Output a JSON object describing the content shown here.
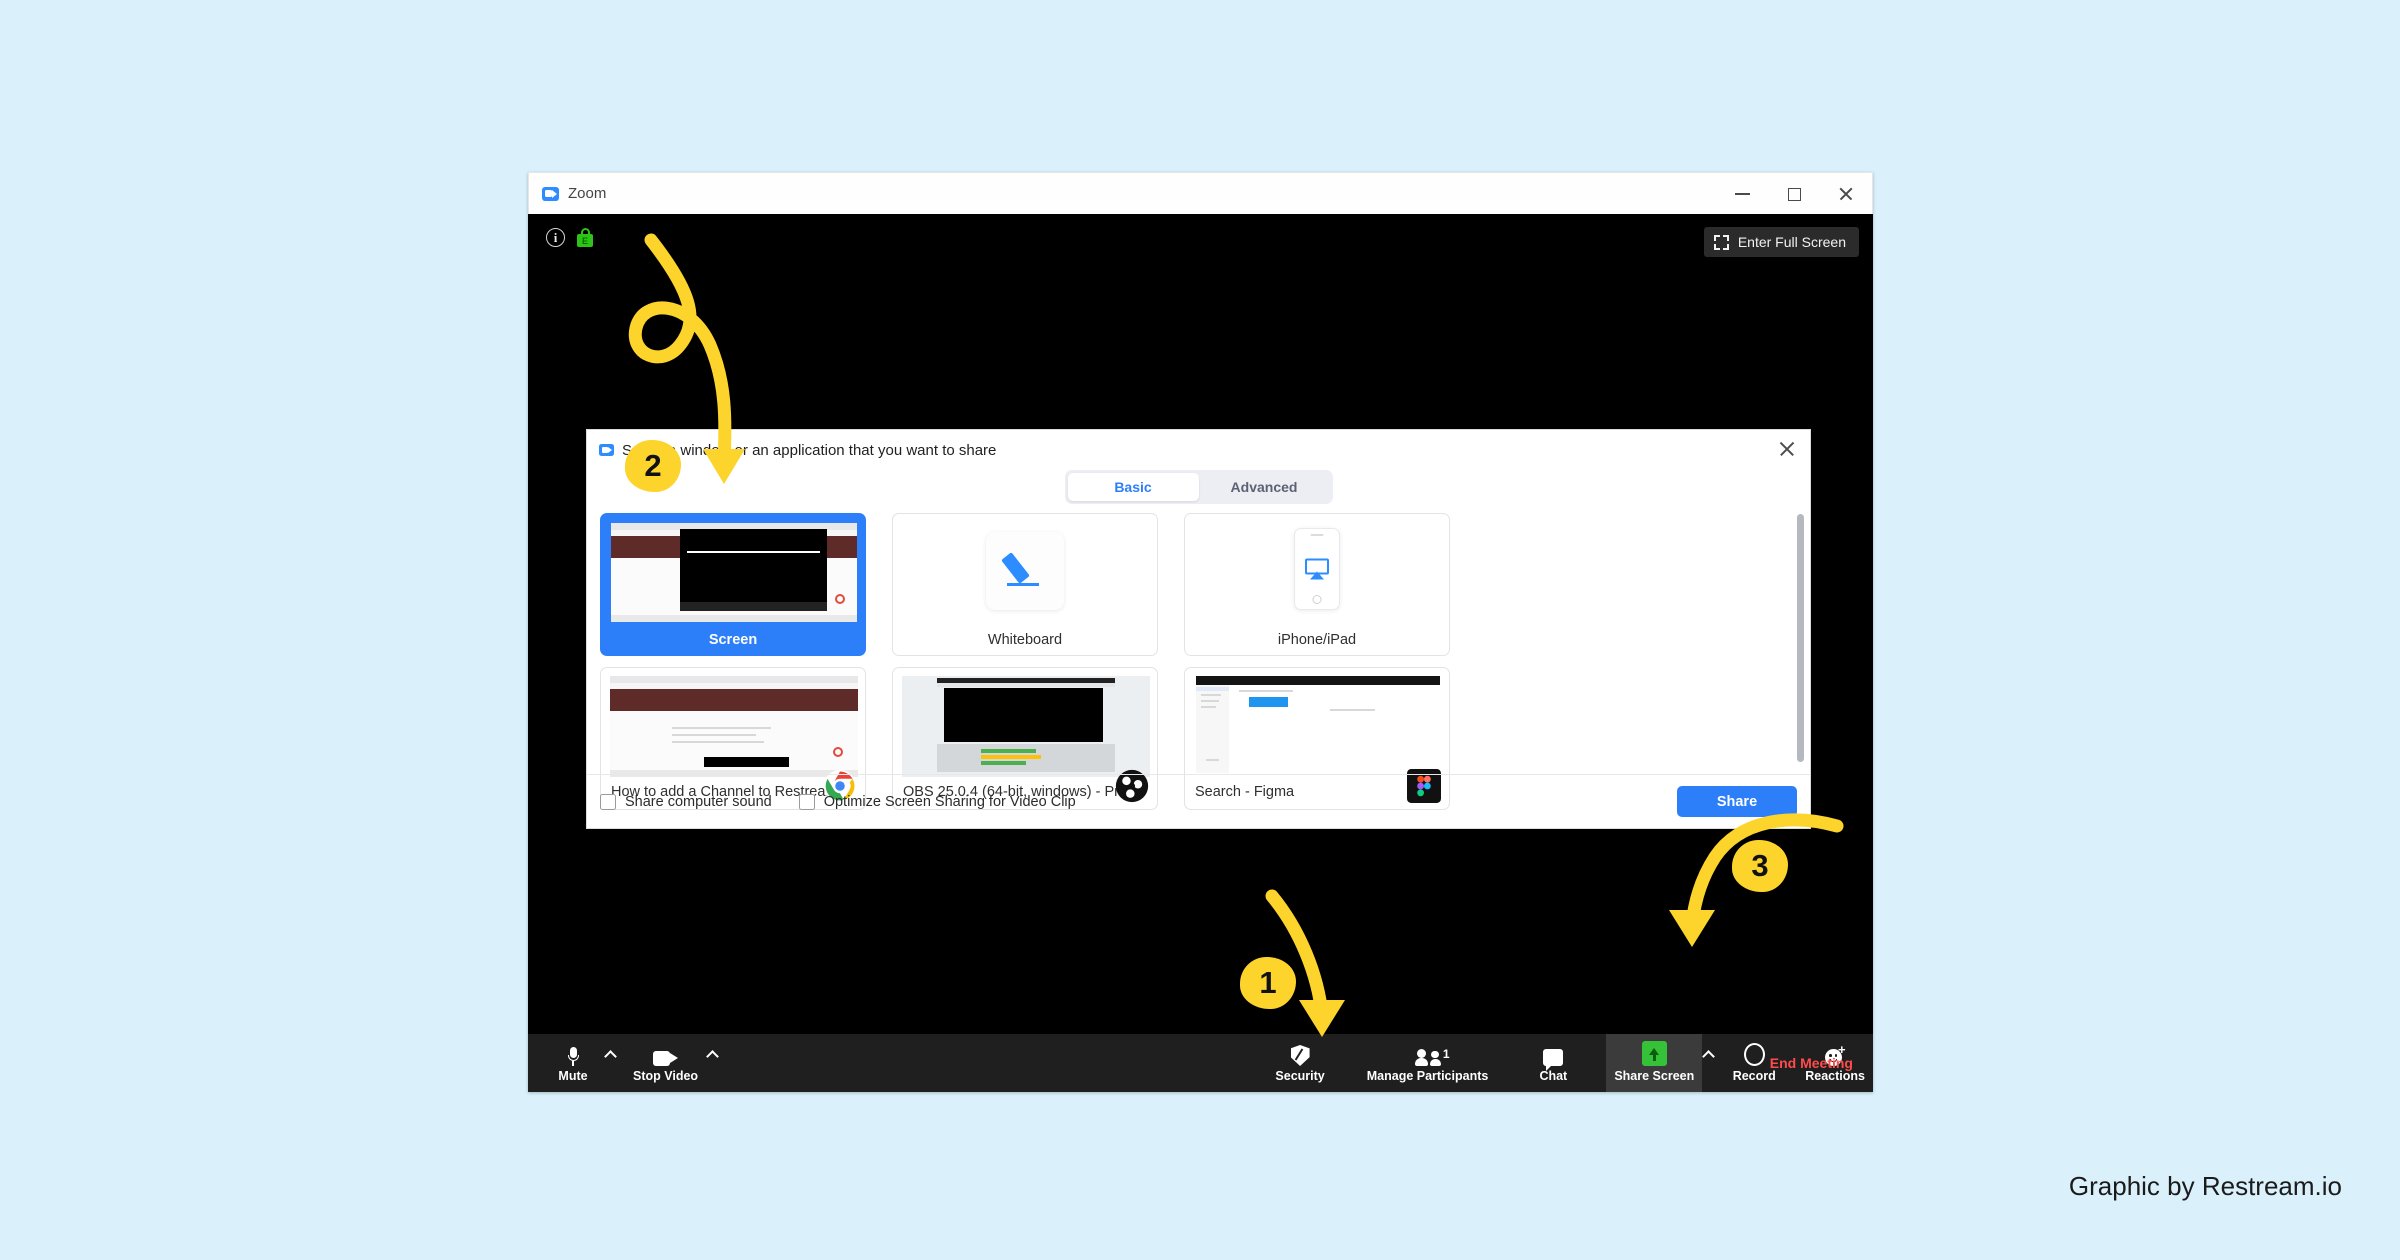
{
  "background_color": "#daf1fc",
  "credit": "Graphic by Restream.io",
  "window": {
    "title": "Zoom",
    "app_icon": "zoom-video-icon",
    "controls": {
      "minimize": "minimize-icon",
      "maximize": "maximize-icon",
      "close": "close-icon"
    }
  },
  "stage": {
    "info_icon": "info-icon",
    "lock_icon": "encryption-lock-icon",
    "fullscreen_label": "Enter Full Screen",
    "fullscreen_icon": "expand-icon"
  },
  "dialog": {
    "title": "Select a window or an application that you want to share",
    "icon": "zoom-video-icon",
    "close_icon": "close-icon",
    "tabs": [
      {
        "label": "Basic",
        "active": true
      },
      {
        "label": "Advanced",
        "active": false
      }
    ],
    "tiles": [
      {
        "label": "Screen",
        "selected": true,
        "kind": "desktop-thumbnail",
        "badge": ""
      },
      {
        "label": "Whiteboard",
        "selected": false,
        "kind": "pen-icon",
        "badge": ""
      },
      {
        "label": "iPhone/iPad",
        "selected": false,
        "kind": "airplay-phone-icon",
        "badge": ""
      },
      {
        "label": "How to add a Channel to Restrea...",
        "selected": false,
        "kind": "browser-thumbnail",
        "badge": "chrome-icon"
      },
      {
        "label": "OBS 25.0.4 (64-bit, windows) - Pr...",
        "selected": false,
        "kind": "obs-thumbnail",
        "badge": "obs-icon"
      },
      {
        "label": "Search - Figma",
        "selected": false,
        "kind": "figma-thumbnail",
        "badge": "figma-icon"
      }
    ],
    "options": [
      {
        "label": "Share computer sound",
        "checked": false
      },
      {
        "label": "Optimize Screen Sharing for Video Clip",
        "checked": false
      }
    ],
    "share_button": "Share",
    "scrollbar": "vertical-scrollbar"
  },
  "toolbar": {
    "items": [
      {
        "label": "Mute",
        "icon": "microphone-icon",
        "has_caret": true,
        "highlighted": false
      },
      {
        "label": "Stop Video",
        "icon": "camera-icon",
        "has_caret": true,
        "highlighted": false
      },
      {
        "label": "Security",
        "icon": "shield-icon",
        "has_caret": false,
        "highlighted": false
      },
      {
        "label": "Manage Participants",
        "icon": "participants-icon",
        "has_caret": false,
        "highlighted": false,
        "count": "1"
      },
      {
        "label": "Chat",
        "icon": "chat-bubble-icon",
        "has_caret": false,
        "highlighted": false
      },
      {
        "label": "Share Screen",
        "icon": "share-screen-icon",
        "has_caret": true,
        "highlighted": true
      },
      {
        "label": "Record",
        "icon": "record-icon",
        "has_caret": false,
        "highlighted": false
      },
      {
        "label": "Reactions",
        "icon": "reactions-icon",
        "has_caret": false,
        "highlighted": false
      }
    ],
    "end_meeting": "End Meeting",
    "end_meeting_color": "#ff4b4b"
  },
  "annotations": {
    "color": "#fcd42b",
    "steps": [
      {
        "number": "1",
        "points_to": "Share Screen"
      },
      {
        "number": "2",
        "points_to": "Select a window or an application that you want to share"
      },
      {
        "number": "3",
        "points_to": "Share"
      }
    ]
  }
}
